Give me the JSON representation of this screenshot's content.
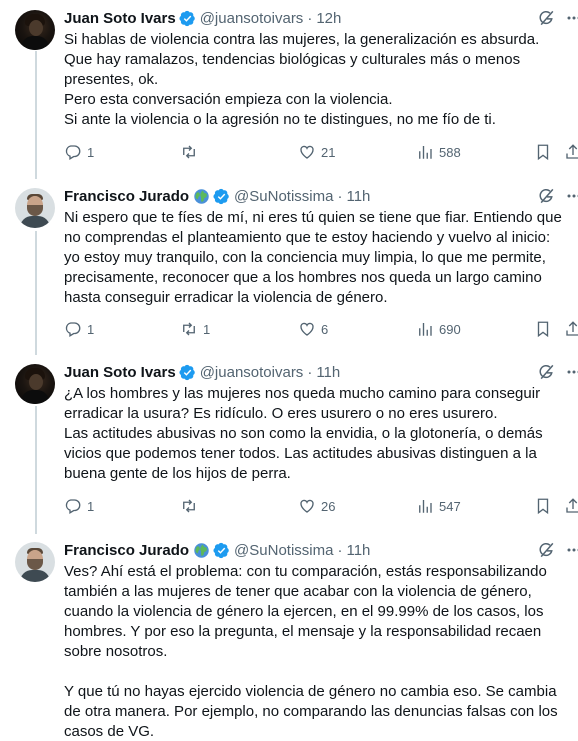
{
  "tweets": [
    {
      "author": "Juan Soto Ivars",
      "handle": "@juansotoivars",
      "time": "12h",
      "lines": [
        "Si hablas de violencia contra las mujeres, la generalización es absurda.",
        "Que hay ramalazos, tendencias biológicas y culturales más o menos",
        "presentes, ok.",
        "Pero esta conversación empieza con la violencia.",
        "Si ante la violencia o la agresión no te distingues, no me fío de ti."
      ],
      "replies": "1",
      "retweets": "",
      "likes": "21",
      "views": "588"
    },
    {
      "author": "Francisco Jurado",
      "handle": "@SuNotissima",
      "time": "11h",
      "lines": [
        "Ni espero que te fíes de mí, ni eres tú quien se tiene que fiar. Entiendo que",
        "no comprendas el planteamiento que te estoy haciendo y vuelvo al inicio:",
        "yo estoy muy tranquilo, con la conciencia muy limpia, lo que me permite,",
        "precisamente, reconocer que a los hombres nos queda un largo camino",
        "hasta conseguir erradicar la violencia de género."
      ],
      "replies": "1",
      "retweets": "1",
      "likes": "6",
      "views": "690"
    },
    {
      "author": "Juan Soto Ivars",
      "handle": "@juansotoivars",
      "time": "11h",
      "lines": [
        "¿A los hombres y las mujeres nos queda mucho camino para conseguir",
        "erradicar la usura? Es ridículo. O eres usurero o no eres usurero.",
        "Las actitudes abusivas no son como la envidia, o la glotonería, o demás",
        "vicios que podemos tener todos. Las actitudes abusivas distinguen a la",
        "buena gente de los hijos de perra."
      ],
      "replies": "1",
      "retweets": "",
      "likes": "26",
      "views": "547"
    },
    {
      "author": "Francisco Jurado",
      "handle": "@SuNotissima",
      "time": "11h",
      "lines": [
        "Ves? Ahí está el problema: con tu comparación, estás responsabilizando",
        "también a las mujeres de tener que acabar con la violencia de género,",
        "cuando la violencia de género la ejercen, en el 99.99% de los casos, los",
        "hombres. Y por eso la pregunta, el mensaje y la responsabilidad recaen",
        "sobre nosotros."
      ],
      "lines2": [
        "Y que tú no hayas ejercido violencia de género no cambia eso. Se cambia",
        "de otra manera. Por ejemplo, no comparando las denuncias falsas con los",
        "casos de VG."
      ]
    }
  ],
  "separator": "·",
  "icons": {
    "verified": "verified-badge-icon",
    "globe": "globe-emoji-icon",
    "grok": "grok-icon",
    "more": "more-icon",
    "reply": "reply-icon",
    "retweet": "retweet-icon",
    "like": "heart-icon",
    "views": "views-icon",
    "bookmark": "bookmark-icon",
    "share": "share-icon"
  },
  "colors": {
    "text": "#0f1419",
    "secondary": "#536471",
    "verified": "#1d9bf0",
    "thread_line": "#cfd9de"
  }
}
